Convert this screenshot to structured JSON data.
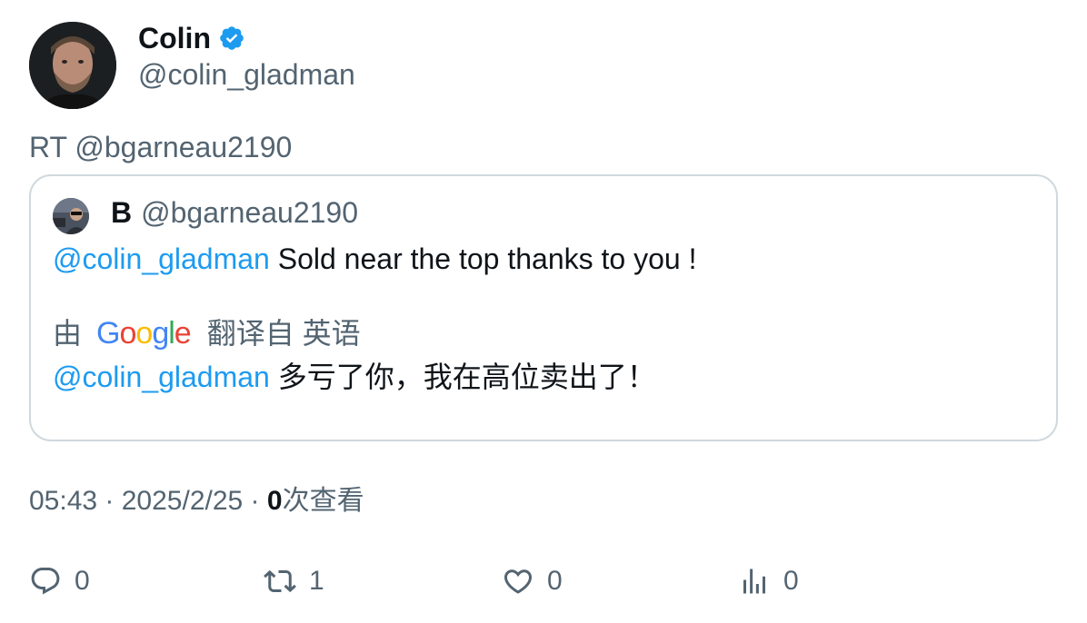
{
  "author": {
    "display_name": "Colin",
    "handle": "@colin_gladman",
    "verified_icon": "verified-badge-icon",
    "badge_color": "#1d9bf0"
  },
  "retweet_text": "RT @bgarneau2190",
  "quote": {
    "name": "B",
    "handle": "@bgarneau2190",
    "mention": "@colin_gladman",
    "text": " Sold near the top thanks to you !",
    "translate_by": "由",
    "translate_from": "翻译自 英语",
    "translated_mention": "@colin_gladman",
    "translated_text": " 多亏了你，我在高位卖出了！"
  },
  "google_logo": {
    "letters": [
      "G",
      "o",
      "o",
      "g",
      "l",
      "e"
    ],
    "colors": [
      "#4285f4",
      "#ea4335",
      "#fbbc05",
      "#4285f4",
      "#34a853",
      "#ea4335"
    ]
  },
  "meta": {
    "time": "05:43",
    "separator": " · ",
    "date": "2025/2/25",
    "views_count": "0",
    "views_label": "次查看"
  },
  "actions": {
    "reply": {
      "icon": "reply-icon",
      "count": "0"
    },
    "retweet": {
      "icon": "retweet-icon",
      "count": "1"
    },
    "like": {
      "icon": "heart-icon",
      "count": "0"
    },
    "views": {
      "icon": "analytics-icon",
      "count": "0"
    }
  },
  "colors": {
    "text_primary": "#0f1419",
    "text_secondary": "#536471",
    "link": "#1d9bf0",
    "border": "#cfd9de"
  }
}
